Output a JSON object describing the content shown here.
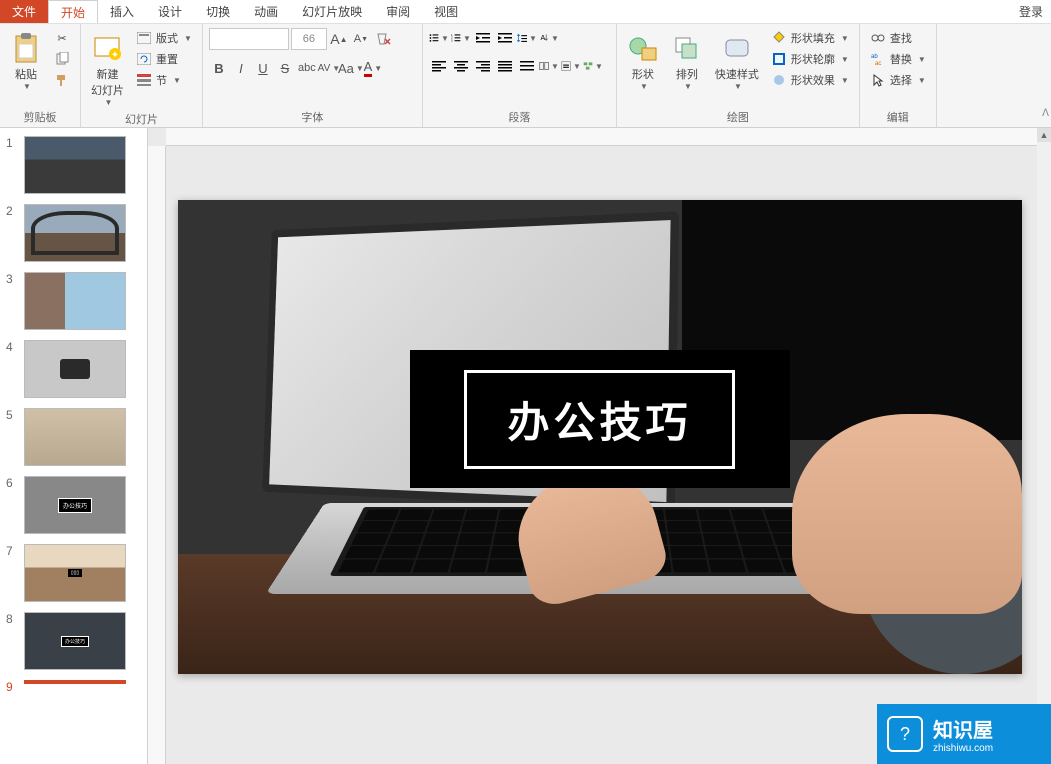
{
  "menu": {
    "file": "文件",
    "home": "开始",
    "insert": "插入",
    "design": "设计",
    "transitions": "切换",
    "animations": "动画",
    "slideshow": "幻灯片放映",
    "review": "审阅",
    "view": "视图",
    "login": "登录"
  },
  "ribbon": {
    "clipboard": {
      "label": "剪贴板",
      "paste": "粘贴"
    },
    "slides": {
      "label": "幻灯片",
      "new_slide": "新建\n幻灯片",
      "layout": "版式",
      "reset": "重置",
      "section": "节"
    },
    "font": {
      "label": "字体",
      "size": "66"
    },
    "paragraph": {
      "label": "段落"
    },
    "drawing": {
      "label": "绘图",
      "shapes": "形状",
      "arrange": "排列",
      "quick_styles": "快速样式",
      "fill": "形状填充",
      "outline": "形状轮廓",
      "effects": "形状效果"
    },
    "editing": {
      "label": "编辑",
      "find": "查找",
      "replace": "替换",
      "select": "选择"
    }
  },
  "slides_panel": [
    {
      "num": "1"
    },
    {
      "num": "2"
    },
    {
      "num": "3"
    },
    {
      "num": "4"
    },
    {
      "num": "5"
    },
    {
      "num": "6"
    },
    {
      "num": "7"
    },
    {
      "num": "8"
    },
    {
      "num": "9"
    }
  ],
  "canvas": {
    "title": "办公技巧"
  },
  "watermark": {
    "main": "知识屋",
    "sub": "zhishiwu.com",
    "icon": "?"
  }
}
